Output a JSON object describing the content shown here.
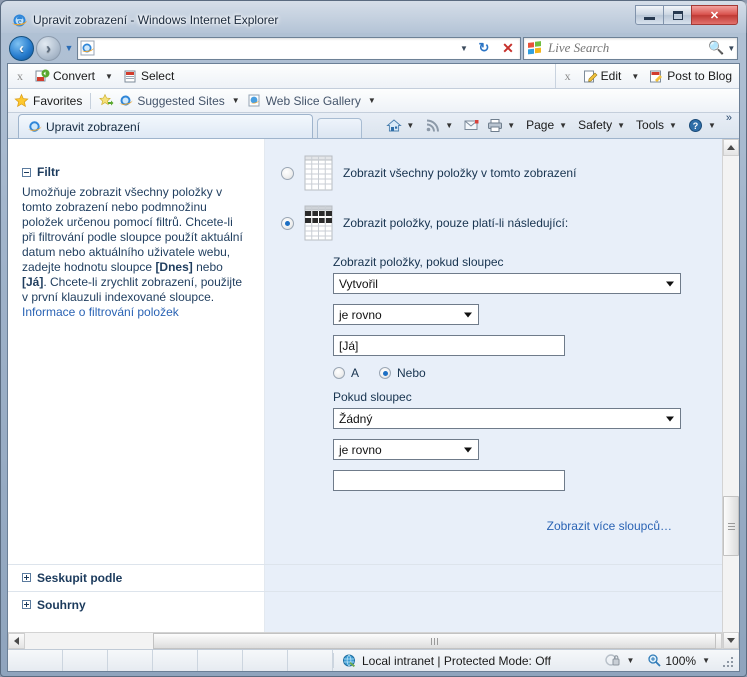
{
  "window": {
    "title": "Upravit zobrazení - Windows Internet Explorer",
    "minimize_label": "Minimize",
    "maximize_label": "Maximize",
    "close_label": "Close"
  },
  "nav": {
    "back_label": "Back",
    "forward_label": "Forward",
    "recent_label": "Recent Pages",
    "address_value": "",
    "address_placeholder": "",
    "refresh_label": "Refresh",
    "stop_label": "Stop",
    "search_value": "",
    "search_placeholder": "Live Search",
    "search_button_label": "Search"
  },
  "addon_bar": {
    "left_close": "x",
    "left_items": [
      {
        "label": "Convert",
        "icon": "convert-icon",
        "has_caret": true
      },
      {
        "label": "Select",
        "icon": "select-icon",
        "has_caret": false
      }
    ],
    "right_close": "x",
    "right_items": [
      {
        "label": "Edit",
        "icon": "edit-icon",
        "has_caret": true
      },
      {
        "label": "Post to Blog",
        "icon": "blog-icon",
        "has_caret": false
      }
    ]
  },
  "favorites_bar": {
    "favorites_label": "Favorites",
    "items": [
      {
        "label": "Suggested Sites",
        "icon": "suggested-sites-icon",
        "has_caret": true
      },
      {
        "label": "Web Slice Gallery",
        "icon": "web-slice-icon",
        "has_caret": true
      }
    ]
  },
  "tabs": {
    "active_tab": "Upravit zobrazení",
    "new_tab_label": ""
  },
  "command_bar": {
    "items": [
      {
        "label": "",
        "icon": "home-icon",
        "has_caret": true
      },
      {
        "label": "",
        "icon": "rss-feed-icon",
        "has_caret": true
      },
      {
        "label": "",
        "icon": "mail-icon",
        "has_caret": false
      },
      {
        "label": "",
        "icon": "print-icon",
        "has_caret": true
      },
      {
        "label": "Page",
        "icon": "",
        "has_caret": true
      },
      {
        "label": "Safety",
        "icon": "",
        "has_caret": true
      },
      {
        "label": "Tools",
        "icon": "",
        "has_caret": true
      },
      {
        "label": "",
        "icon": "help-icon",
        "has_caret": true
      }
    ],
    "overflow_label": "»"
  },
  "content": {
    "filter_section": {
      "heading": "Filtr",
      "description_part1": "Umožňuje zobrazit všechny položky v tomto zobrazení nebo podmnožinu položek určenou pomocí filtrů. Chcete-li při filtrování podle sloupce použít aktuální datum nebo aktuálního uživatele webu, zadejte hodnotu sloupce ",
      "token_today": "[Dnes]",
      "description_part2": " nebo ",
      "token_me": "[Já]",
      "description_part3": ". Chcete-li zrychlit zobrazení, použijte v první klauzuli indexované sloupce.",
      "help_link": "Informace o filtrování položek",
      "option_show_all": "Zobrazit všechny položky v tomto zobrazení",
      "option_show_filtered": "Zobrazit položky, pouze platí-li následující:",
      "label_when_column": "Zobrazit položky, pokud sloupec",
      "column1_value": "Vytvořil",
      "operator1_value": "je rovno",
      "value1_value": "[Já]",
      "and_label": "A",
      "or_label": "Nebo",
      "label_when_column2": "Pokud sloupec",
      "column2_value": "Žádný",
      "operator2_value": "je rovno",
      "value2_value": "",
      "show_more_columns_link": "Zobrazit více sloupců…",
      "selected_mode": "filtered"
    },
    "group_by_section": {
      "heading": "Seskupit podle"
    },
    "totals_section": {
      "heading": "Souhrny"
    }
  },
  "status_bar": {
    "zone_text": "Local intranet | Protected Mode: Off",
    "privacy_label": "Privacy Report",
    "zoom_level": "100%"
  },
  "colors": {
    "accent_blue": "#2a63b4",
    "panel_blue": "#e8eff9",
    "heading_blue": "#1b3a5c",
    "close_red": "#c03a35"
  }
}
